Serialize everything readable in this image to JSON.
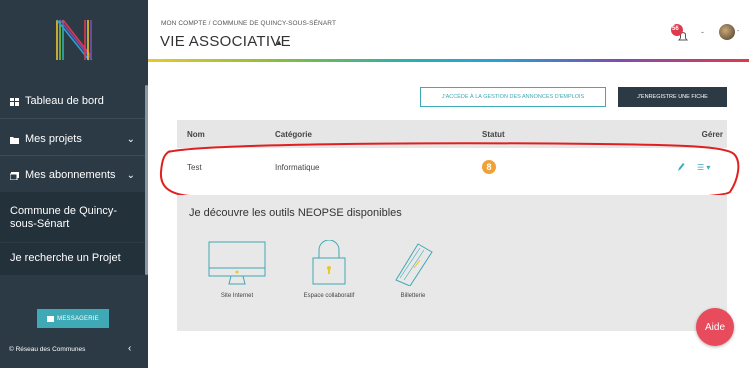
{
  "sidebar": {
    "items": [
      {
        "label": "Tableau de bord",
        "icon": "dashboard-icon"
      },
      {
        "label": "Mes projets",
        "icon": "folder-icon"
      },
      {
        "label": "Mes abonnements",
        "icon": "subscriptions-icon"
      }
    ],
    "commune": "Commune de Quincy-sous-Sénart",
    "projet": "Je recherche un Projet",
    "messagerie": "MESSAGERIE",
    "footer": "© Réseau des Communes"
  },
  "header": {
    "breadcrumb": "MON COMPTE / COMMUNE DE QUINCY-SOUS-SÉNART",
    "title": "VIE ASSOCIATIVE",
    "notification_count": "56"
  },
  "actions": {
    "emploi_label": "J'ACCÈDE À LA GESTION DES ANNONCES D'EMPLOIS",
    "fiche_label": "J'ENREGISTRE UNE FICHE"
  },
  "table": {
    "columns": {
      "nom": "Nom",
      "categorie": "Catégorie",
      "statut": "Statut",
      "gerer": "Gérer"
    },
    "rows": [
      {
        "nom": "Test",
        "categorie": "Informatique",
        "statut_icon": "8"
      }
    ]
  },
  "outils": {
    "title": "Je découvre les outils NEOPSE disponibles",
    "tools": [
      {
        "label": "Site Internet",
        "icon": "monitor-icon"
      },
      {
        "label": "Espace collaboratif",
        "icon": "lock-icon"
      },
      {
        "label": "Billetterie",
        "icon": "ticket-icon"
      }
    ]
  },
  "aide": "Aide",
  "colors": {
    "sidebar": "#2b3a45",
    "accent": "#3fa9b5",
    "status": "#f0a238",
    "aide": "#e84b5c",
    "annotation": "#e02020"
  }
}
